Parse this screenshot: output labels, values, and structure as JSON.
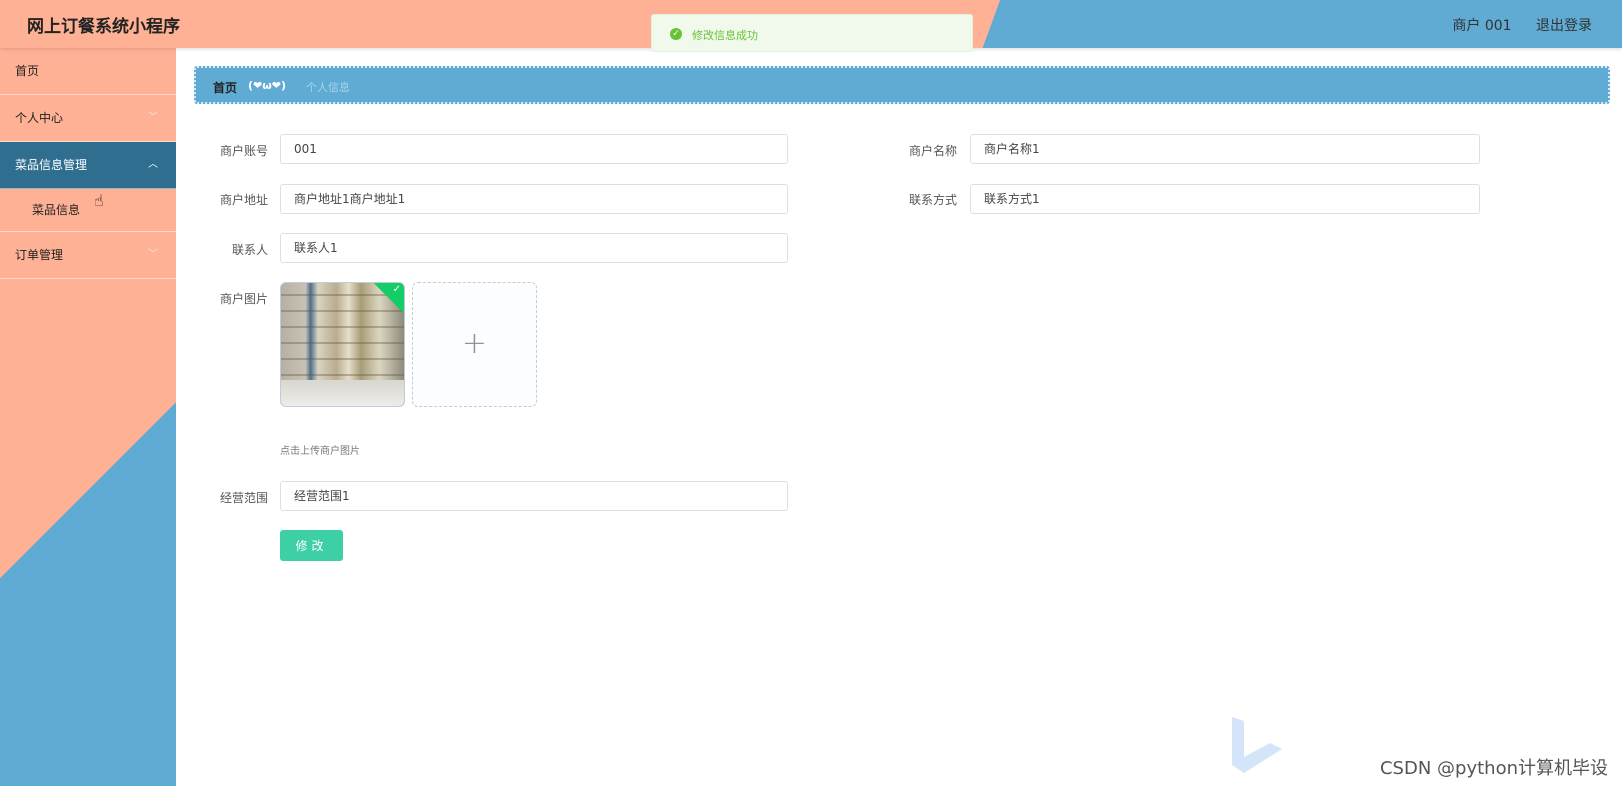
{
  "header": {
    "app_title": "网上订餐系统小程序",
    "user_label": "商户 001",
    "logout_label": "退出登录"
  },
  "toast": {
    "message": "修改信息成功"
  },
  "sidebar": {
    "items": [
      {
        "label": "首页"
      },
      {
        "label": "个人中心"
      },
      {
        "label": "菜品信息管理"
      },
      {
        "label": "订单管理"
      }
    ],
    "sub_items": [
      {
        "label": "菜品信息"
      }
    ]
  },
  "breadcrumb": {
    "home": "首页",
    "separator": "(❤ω❤)",
    "current": "个人信息"
  },
  "form": {
    "account_label": "商户账号",
    "account_value": "001",
    "name_label": "商户名称",
    "name_value": "商户名称1",
    "address_label": "商户地址",
    "address_value": "商户地址1商户地址1",
    "contact_label": "联系方式",
    "contact_value": "联系方式1",
    "person_label": "联系人",
    "person_value": "联系人1",
    "image_label": "商户图片",
    "upload_hint": "点击上传商户图片",
    "scope_label": "经营范围",
    "scope_value": "经营范围1",
    "submit_label": "修改"
  },
  "watermark": "CSDN @python计算机毕设",
  "colors": {
    "header_left": "#ffb195",
    "header_right": "#5fabd4",
    "active_menu": "#2f6e8f",
    "submit": "#3dcfa5",
    "success": "#67c23a"
  }
}
